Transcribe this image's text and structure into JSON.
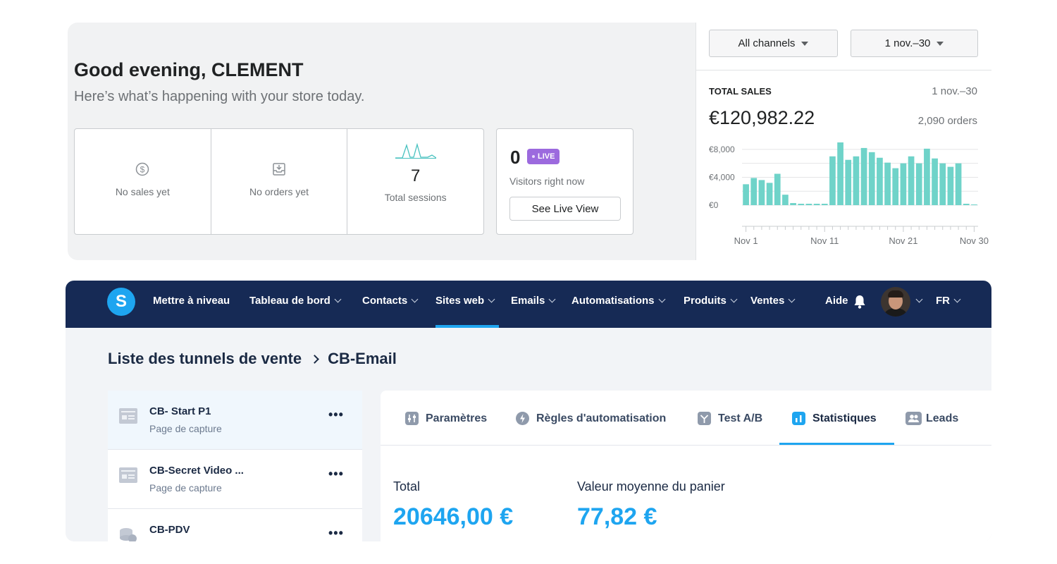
{
  "shopify": {
    "greeting": "Good evening, CLEMENT",
    "subtitle": "Here’s what’s happening with your store today.",
    "metrics": [
      {
        "icon": "dollar-circle-icon",
        "label": "No sales yet"
      },
      {
        "icon": "inbox-download-icon",
        "label": "No orders yet"
      },
      {
        "icon": "sparkline-icon",
        "value": "7",
        "label": "Total sessions"
      }
    ],
    "live": {
      "count": "0",
      "badge": "LIVE",
      "visitors_label": "Visitors right now",
      "button": "See Live View"
    },
    "filters": {
      "channels": "All channels",
      "date": "1 nov.–30"
    },
    "total_sales": {
      "label": "TOTAL SALES",
      "range": "1 nov.–30",
      "value": "€120,982.22",
      "orders": "2,090 orders"
    },
    "accent_color": "#6fd3c9"
  },
  "chart_data": {
    "type": "bar",
    "title": "",
    "xlabel": "",
    "ylabel": "",
    "x_tick_labels": [
      "Nov 1",
      "Nov 11",
      "Nov 21",
      "Nov 30"
    ],
    "y_tick_labels": [
      "€8,000",
      "€4,000",
      "€0"
    ],
    "ylim": [
      0,
      9000
    ],
    "grid": true,
    "x": [
      1,
      2,
      3,
      4,
      5,
      6,
      7,
      8,
      9,
      10,
      11,
      12,
      13,
      14,
      15,
      16,
      17,
      18,
      19,
      20,
      21,
      22,
      23,
      24,
      25,
      26,
      27,
      28,
      29,
      30
    ],
    "values": [
      3000,
      3900,
      3600,
      3200,
      4500,
      1500,
      300,
      200,
      200,
      200,
      200,
      7000,
      9000,
      6500,
      7000,
      8200,
      7600,
      6800,
      6100,
      5300,
      6000,
      7000,
      6000,
      8100,
      6700,
      6000,
      5500,
      6000,
      200,
      100
    ],
    "color": "#6fd3c9"
  },
  "systeme": {
    "logo": "S",
    "nav": [
      {
        "label": "Mettre à niveau",
        "chevron": false
      },
      {
        "label": "Tableau de bord",
        "chevron": true
      },
      {
        "label": "Contacts",
        "chevron": true
      },
      {
        "label": "Sites web",
        "chevron": true,
        "active": true
      },
      {
        "label": "Emails",
        "chevron": true
      },
      {
        "label": "Automatisations",
        "chevron": true
      },
      {
        "label": "Produits",
        "chevron": true
      },
      {
        "label": "Ventes",
        "chevron": true
      },
      {
        "label": "Aide",
        "chevron": false
      }
    ],
    "language": "FR",
    "breadcrumb": {
      "parent": "Liste des tunnels de vente",
      "current": "CB-Email"
    },
    "funnel_steps": [
      {
        "name": "CB- Start P1",
        "type": "Page de capture",
        "icon": "page-icon",
        "active": true
      },
      {
        "name": "CB-Secret Video ...",
        "type": "Page de capture",
        "icon": "page-icon"
      },
      {
        "name": "CB-PDV",
        "type": "",
        "icon": "coins-icon"
      }
    ],
    "more_label": "•••",
    "tabs": [
      {
        "label": "Paramètres",
        "icon": "sliders-icon"
      },
      {
        "label": "Règles d'automatisation",
        "icon": "lightning-icon"
      },
      {
        "label": "Test A/B",
        "icon": "split-icon"
      },
      {
        "label": "Statistiques",
        "icon": "bar-chart-icon",
        "active": true
      },
      {
        "label": "Leads",
        "icon": "users-icon"
      }
    ],
    "stats": {
      "total_label": "Total",
      "total_value": "20646,00 €",
      "avg_label": "Valeur moyenne du panier",
      "avg_value": "77,82 €"
    },
    "brand_color": "#1ea5f0",
    "nav_color": "#162a55"
  }
}
